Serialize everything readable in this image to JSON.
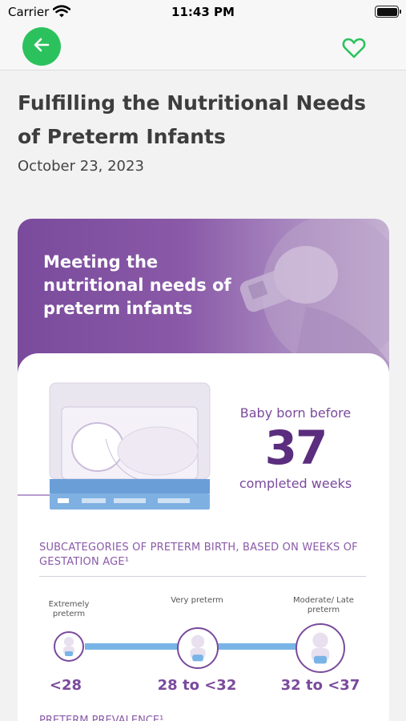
{
  "status_bar": {
    "carrier": "Carrier",
    "time": "11:43 PM"
  },
  "nav": {
    "back_icon": "arrow-left-icon",
    "favorite_icon": "heart-outline-icon",
    "accent": "#2bc25e"
  },
  "article": {
    "title": "Fulfilling the Nutritional Needs of Preterm Infants",
    "date": "October 23, 2023"
  },
  "infographic": {
    "hero_title": "Meeting the nutritional needs of preterm infants",
    "born_before": "Baby born before",
    "weeks_number": "37",
    "completed_weeks": "completed weeks",
    "subcategories_heading": "SUBCATEGORIES OF PRETERM BIRTH, BASED ON  WEEKS OF GESTATION AGE¹",
    "categories": [
      {
        "label": "Extremely preterm",
        "range": "<28"
      },
      {
        "label": "Very preterm",
        "range": "28 to <32"
      },
      {
        "label": "Moderate/ Late preterm",
        "range": "32 to <37"
      }
    ],
    "next_heading": "PRETERM PREVALENCE¹",
    "colors": {
      "purple": "#7a4a9c",
      "dark_purple": "#5b2d7e",
      "blue": "#79b4e6"
    }
  }
}
